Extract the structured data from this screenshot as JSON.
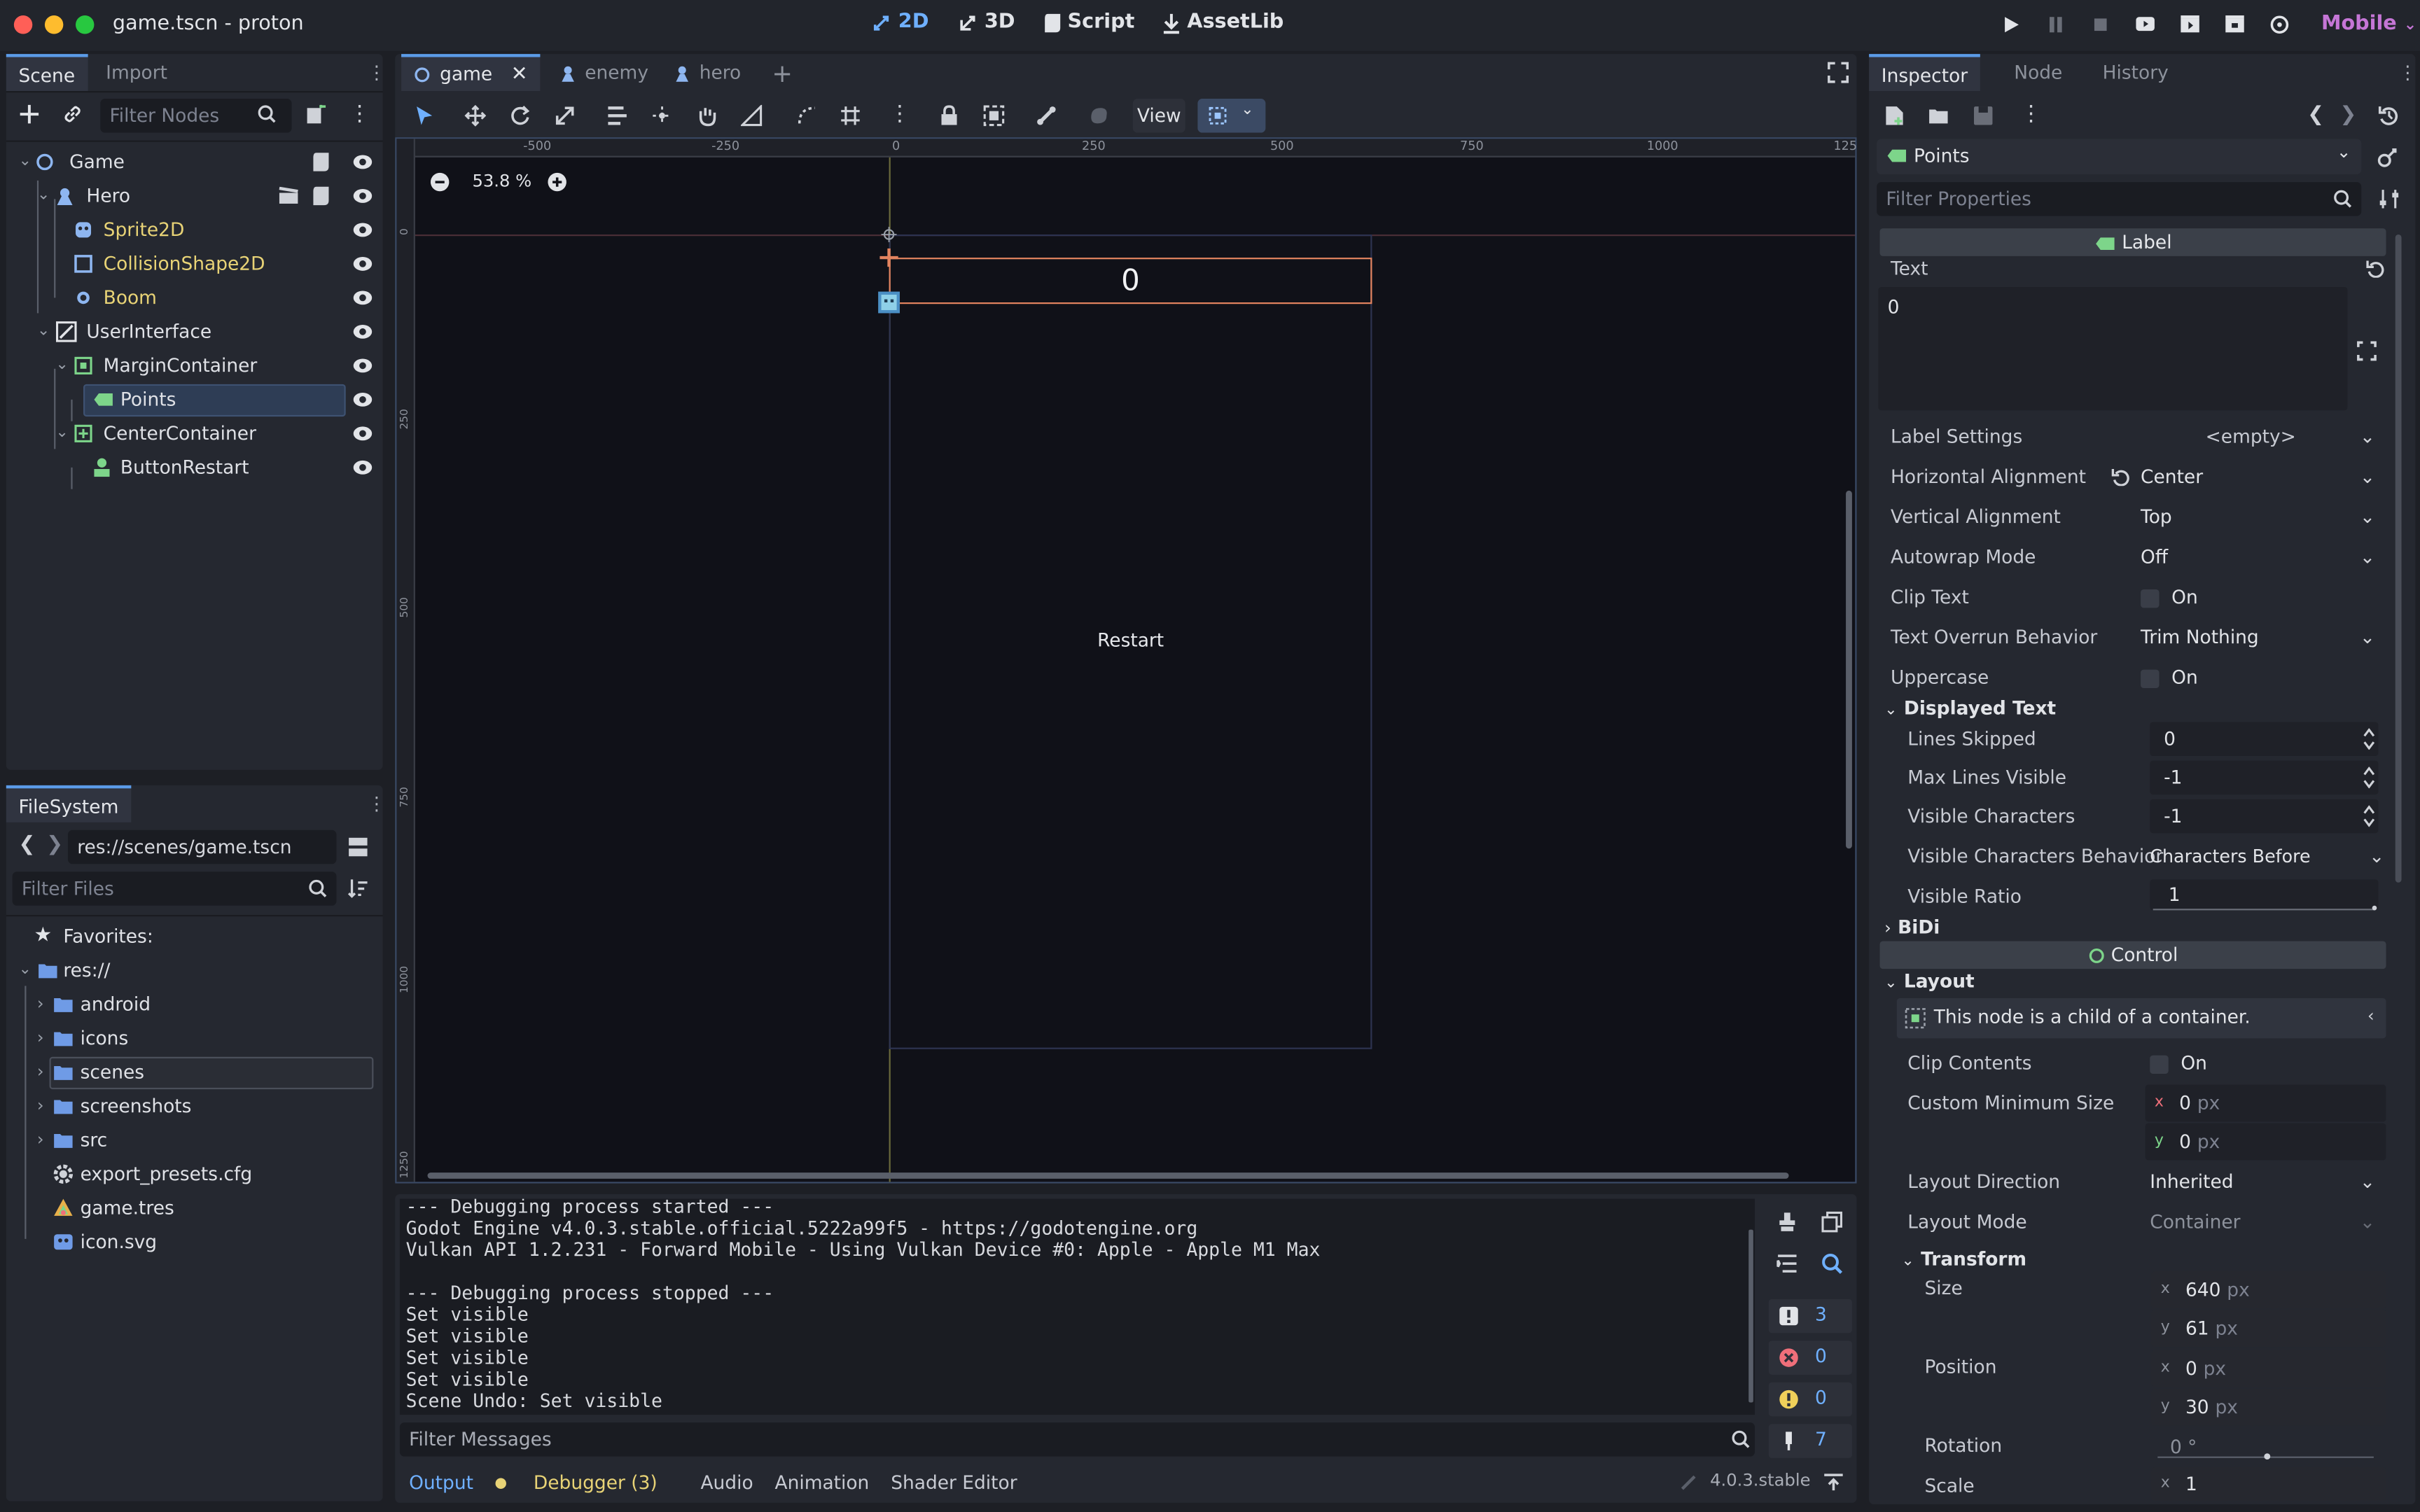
{
  "window": {
    "title": "game.tscn - proton"
  },
  "workspaces": [
    "2D",
    "3D",
    "Script",
    "AssetLib"
  ],
  "renderer": "Mobile",
  "scene_dock": {
    "tabs": [
      "Scene",
      "Import"
    ],
    "filter_placeholder": "Filter Nodes",
    "nodes": [
      {
        "label": "Game"
      },
      {
        "label": "Hero"
      },
      {
        "label": "Sprite2D"
      },
      {
        "label": "CollisionShape2D"
      },
      {
        "label": "Boom"
      },
      {
        "label": "UserInterface"
      },
      {
        "label": "MarginContainer"
      },
      {
        "label": "Points"
      },
      {
        "label": "CenterContainer"
      },
      {
        "label": "ButtonRestart"
      }
    ]
  },
  "filesystem": {
    "tab": "FileSystem",
    "path": "res://scenes/game.tscn",
    "filter_placeholder": "Filter Files",
    "items": [
      {
        "label": "Favorites:"
      },
      {
        "label": "res://"
      },
      {
        "label": "android"
      },
      {
        "label": "icons"
      },
      {
        "label": "scenes"
      },
      {
        "label": "screenshots"
      },
      {
        "label": "src"
      },
      {
        "label": "export_presets.cfg"
      },
      {
        "label": "game.tres"
      },
      {
        "label": "icon.svg"
      }
    ]
  },
  "editor": {
    "tabs": [
      "game",
      "enemy",
      "hero"
    ],
    "view_label": "View",
    "zoom": "53.8 %",
    "ruler_marks": [
      "-500",
      "-250",
      "0",
      "250",
      "500",
      "750",
      "1000",
      "125"
    ],
    "vruler_marks": [
      "0",
      "250",
      "500",
      "750",
      "1000",
      "1250"
    ],
    "label_text": "0",
    "button_text": "Restart"
  },
  "console": {
    "lines": [
      "--- Debugging process started ---",
      "Godot Engine v4.0.3.stable.official.5222a99f5 - https://godotengine.org",
      "Vulkan API 1.2.231 - Forward Mobile - Using Vulkan Device #0: Apple - Apple M1 Max",
      "",
      "--- Debugging process stopped ---",
      "Set visible",
      "Set visible",
      "Set visible",
      "Set visible",
      "Scene Undo: Set visible"
    ],
    "filter_placeholder": "Filter Messages",
    "counts": {
      "messages": "3",
      "errors": "0",
      "warnings": "0",
      "pins": "7"
    }
  },
  "bottom_tabs": [
    "Output",
    "Debugger (3)",
    "Audio",
    "Animation",
    "Shader Editor"
  ],
  "version": "4.0.3.stable",
  "inspector": {
    "tabs": [
      "Inspector",
      "Node",
      "History"
    ],
    "object": "Points",
    "filter_placeholder": "Filter Properties",
    "label_header": "Label",
    "text_key": "Text",
    "text_value": "0",
    "props": {
      "label_settings": {
        "k": "Label Settings",
        "v": "<empty>"
      },
      "h_align": {
        "k": "Horizontal Alignment",
        "v": "Center"
      },
      "v_align": {
        "k": "Vertical Alignment",
        "v": "Top"
      },
      "autowrap": {
        "k": "Autowrap Mode",
        "v": "Off"
      },
      "clip_text": {
        "k": "Clip Text",
        "v": "On"
      },
      "overrun": {
        "k": "Text Overrun Behavior",
        "v": "Trim Nothing"
      },
      "uppercase": {
        "k": "Uppercase",
        "v": "On"
      },
      "lines_skipped": {
        "k": "Lines Skipped",
        "v": "0"
      },
      "max_lines": {
        "k": "Max Lines Visible",
        "v": "-1"
      },
      "visible_chars": {
        "k": "Visible Characters",
        "v": "-1"
      },
      "visible_chars_behavior": {
        "k": "Visible Characters Behavior",
        "v": "Characters Before Shaping"
      },
      "visible_ratio": {
        "k": "Visible Ratio",
        "v": "1"
      },
      "clip_contents": {
        "k": "Clip Contents",
        "v": "On"
      },
      "custom_min_size": {
        "k": "Custom Minimum Size",
        "x": "0",
        "y": "0",
        "unit": "px"
      },
      "layout_direction": {
        "k": "Layout Direction",
        "v": "Inherited"
      },
      "layout_mode": {
        "k": "Layout Mode",
        "v": "Container"
      },
      "size": {
        "k": "Size",
        "x": "640",
        "y": "61",
        "unit": "px"
      },
      "position": {
        "k": "Position",
        "x": "0",
        "y": "30",
        "unit": "px"
      },
      "rotation": {
        "k": "Rotation",
        "v": "0 °"
      },
      "scale": {
        "k": "Scale",
        "x": "1"
      }
    },
    "sections": {
      "displayed_text": "Displayed Text",
      "bidi": "BiDi",
      "layout": "Layout",
      "transform": "Transform"
    },
    "control_header": "Control",
    "container_note": "This node is a child of a container."
  },
  "colors": {
    "accent": "#5b9be8",
    "yellow": "#e8d376",
    "selection": "#2e3d55",
    "renderer": "#c576d6"
  }
}
